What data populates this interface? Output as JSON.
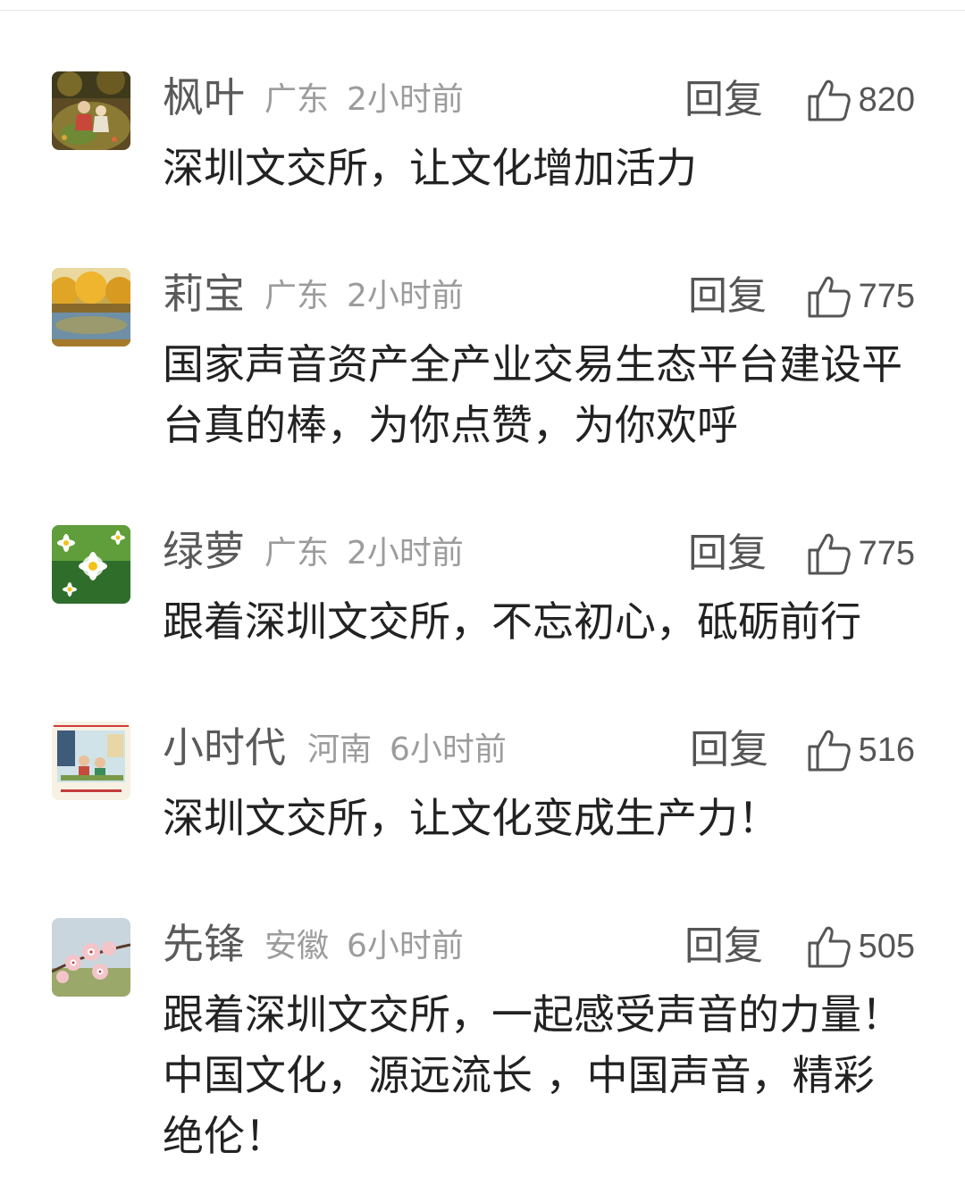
{
  "comments": [
    {
      "username": "枫叶",
      "location": "广东",
      "time": "2小时前",
      "reply_label": "回复",
      "likes": "820",
      "text": "深圳文交所，让文化增加活力",
      "avatar_icon": "autumn-garden-avatar"
    },
    {
      "username": "莉宝",
      "location": "广东",
      "time": "2小时前",
      "reply_label": "回复",
      "likes": "775",
      "text": "国家声音资产全产业交易生态平台建设平台真的棒，为你点赞，为你欢呼",
      "avatar_icon": "golden-trees-lake-avatar"
    },
    {
      "username": "绿萝",
      "location": "广东",
      "time": "2小时前",
      "reply_label": "回复",
      "likes": "775",
      "text": "跟着深圳文交所，不忘初心，砥砺前行",
      "avatar_icon": "daisy-flowers-avatar"
    },
    {
      "username": "小时代",
      "location": "河南",
      "time": "6小时前",
      "reply_label": "回复",
      "likes": "516",
      "text": "深圳文交所，让文化变成生产力！",
      "avatar_icon": "poster-illustration-avatar"
    },
    {
      "username": "先锋",
      "location": "安徽",
      "time": "6小时前",
      "reply_label": "回复",
      "likes": "505",
      "text": "跟着深圳文交所，一起感受声音的力量！中国文化，源远流长 ，中国声音，精彩绝伦！",
      "avatar_icon": "peach-blossom-avatar"
    }
  ],
  "colors": {
    "username": "#5a5a5a",
    "meta": "#9c9c9c",
    "text": "#222222",
    "action": "#555555"
  }
}
